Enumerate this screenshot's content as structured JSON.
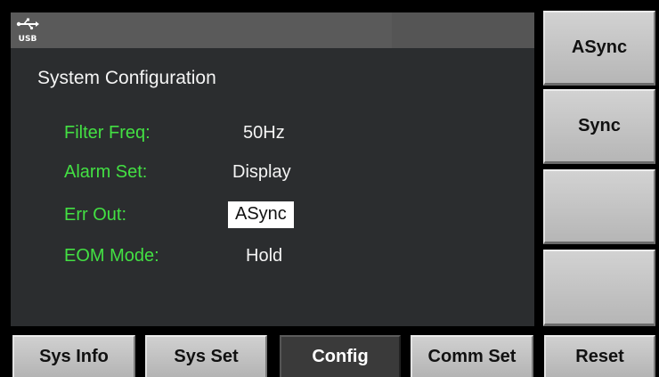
{
  "status_bar": {
    "usb_label": "USB"
  },
  "page": {
    "title": "System Configuration"
  },
  "settings": [
    {
      "label": "Filter Freq:",
      "value": "50Hz"
    },
    {
      "label": "Alarm Set:",
      "value": "Display"
    },
    {
      "label": "Err Out:",
      "value": "ASync",
      "selected": true
    },
    {
      "label": "EOM Mode:",
      "value": "Hold"
    }
  ],
  "softkeys": [
    "ASync",
    "Sync",
    "",
    ""
  ],
  "tabs": [
    {
      "label": "Sys Info",
      "active": false
    },
    {
      "label": "Sys Set",
      "active": false
    },
    {
      "label": "Config",
      "active": true
    },
    {
      "label": "Comm Set",
      "active": false
    },
    {
      "label": "Reset",
      "active": false
    }
  ],
  "colors": {
    "label_green": "#43e043",
    "panel_bg": "#2b2d2f",
    "button_face": "#c4c4c4",
    "active_tab": "#3a3a3a"
  }
}
